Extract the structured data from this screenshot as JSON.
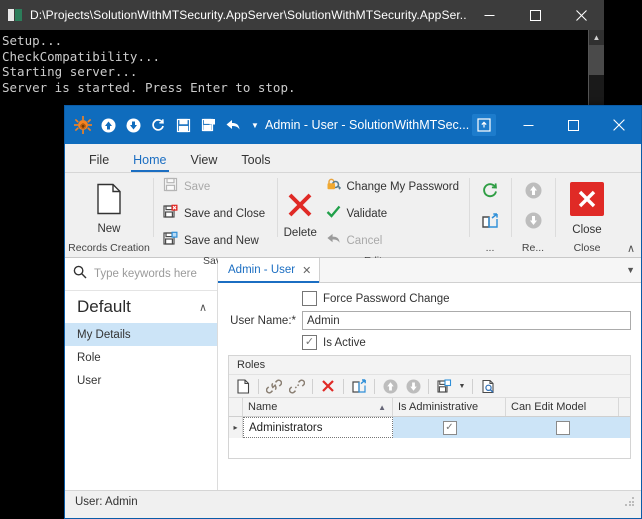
{
  "console": {
    "title": "D:\\Projects\\SolutionWithMTSecurity.AppServer\\SolutionWithMTSecurity.AppSer...",
    "icon": "console-icon",
    "lines": "Setup...\nCheckCompatibility...\nStarting server...\nServer is started. Press Enter to stop.",
    "window_buttons": [
      {
        "name": "minimize",
        "glyph": "—"
      },
      {
        "name": "maximize",
        "glyph": "☐"
      },
      {
        "name": "close",
        "glyph": "✕"
      }
    ]
  },
  "app": {
    "title": "Admin - User - SolutionWithMTSec...",
    "logo": "app-logo-icon",
    "quick_access": [
      {
        "name": "navigate-up-icon",
        "label": "Up"
      },
      {
        "name": "navigate-down-icon",
        "label": "Down"
      },
      {
        "name": "refresh-icon",
        "label": "Refresh"
      },
      {
        "name": "save-icon",
        "label": "Save"
      },
      {
        "name": "save-and-close-icon",
        "label": "Save and Close"
      },
      {
        "name": "undo-icon",
        "label": "Undo"
      }
    ],
    "qat_caret": "▼",
    "ribbon_display_options": "ribbon-display-options-icon",
    "window_buttons": [
      {
        "name": "minimize",
        "glyph": "—"
      },
      {
        "name": "maximize",
        "glyph": "☐"
      },
      {
        "name": "close",
        "glyph": "✕"
      }
    ],
    "tabs": [
      {
        "label": "File",
        "active": false
      },
      {
        "label": "Home",
        "active": true
      },
      {
        "label": "View",
        "active": false
      },
      {
        "label": "Tools",
        "active": false
      }
    ],
    "ribbon": {
      "collapse_chevron": "∧",
      "groups": [
        {
          "label": "Records Creation",
          "big_buttons": [
            {
              "label": "New",
              "icon": "new-document-icon"
            }
          ]
        },
        {
          "label": "Save",
          "small_buttons": [
            {
              "label": "Save",
              "icon": "save-icon",
              "disabled": true
            },
            {
              "label": "Save and Close",
              "icon": "save-and-close-icon",
              "disabled": false
            },
            {
              "label": "Save and New",
              "icon": "save-and-new-icon",
              "disabled": false
            }
          ]
        },
        {
          "label": "Edit",
          "big_buttons": [
            {
              "label": "Delete",
              "icon": "delete-x-icon"
            }
          ],
          "small_buttons": [
            {
              "label": "Change My Password",
              "icon": "key-lock-icon",
              "disabled": false
            },
            {
              "label": "Validate",
              "icon": "validate-check-icon",
              "disabled": false
            },
            {
              "label": "Cancel",
              "icon": "cancel-undo-icon",
              "disabled": true
            }
          ]
        },
        {
          "label": "...",
          "icons": [
            {
              "name": "refresh-icon"
            },
            {
              "name": "export-icon"
            }
          ]
        },
        {
          "label": "Re...",
          "icons": [
            {
              "name": "record-up-icon",
              "disabled": true
            },
            {
              "name": "record-down-icon",
              "disabled": true
            }
          ]
        },
        {
          "label": "Close",
          "big_buttons": [
            {
              "label": "Close",
              "icon": "close-x-icon"
            }
          ]
        }
      ]
    },
    "navigation": {
      "search_placeholder": "Type keywords here",
      "search_icon": "search-icon",
      "group_title": "Default",
      "group_chevron": "∧",
      "items": [
        {
          "label": "My Details",
          "selected": true
        },
        {
          "label": "Role",
          "selected": false
        },
        {
          "label": "User",
          "selected": false
        }
      ]
    },
    "document_tab": {
      "label": "Admin - User",
      "close_glyph": "✕",
      "overflow_caret": "▼"
    },
    "form": {
      "force_password_change": {
        "label": "Force Password Change",
        "checked": false,
        "mark": ""
      },
      "user_name": {
        "label": "User Name:*",
        "value": "Admin",
        "placeholder": ""
      },
      "is_active": {
        "label": "Is Active",
        "checked": true,
        "mark": "✓"
      }
    },
    "roles": {
      "title": "Roles",
      "toolbar": [
        {
          "name": "new-record-icon"
        },
        {
          "name": "link-icon"
        },
        {
          "name": "unlink-icon"
        },
        {
          "name": "delete-x-icon"
        },
        {
          "name": "export-icon"
        },
        {
          "name": "move-up-icon"
        },
        {
          "name": "move-down-icon"
        },
        {
          "name": "save-layout-icon"
        },
        {
          "name": "preview-icon"
        }
      ],
      "toolbar_caret": "▼",
      "columns": [
        {
          "label": "Name",
          "sort": "▲"
        },
        {
          "label": "Is Administrative",
          "sort": ""
        },
        {
          "label": "Can Edit Model",
          "sort": ""
        }
      ],
      "rows": [
        {
          "indicator": "▸",
          "name": "Administrators",
          "is_administrative": true,
          "can_edit_model": false,
          "check_mark": "✓"
        }
      ]
    },
    "statusbar": {
      "text": "User: Admin"
    }
  },
  "colors": {
    "title_blue": "#0f6cbd",
    "accent_blue": "#1b6ec2",
    "selection_blue": "#cce4f7",
    "danger_red": "#e02a26",
    "valid_green": "#21a04a",
    "refresh_green": "#2f9e44",
    "console_bg": "#000000",
    "console_title": "#3c3c3c"
  }
}
